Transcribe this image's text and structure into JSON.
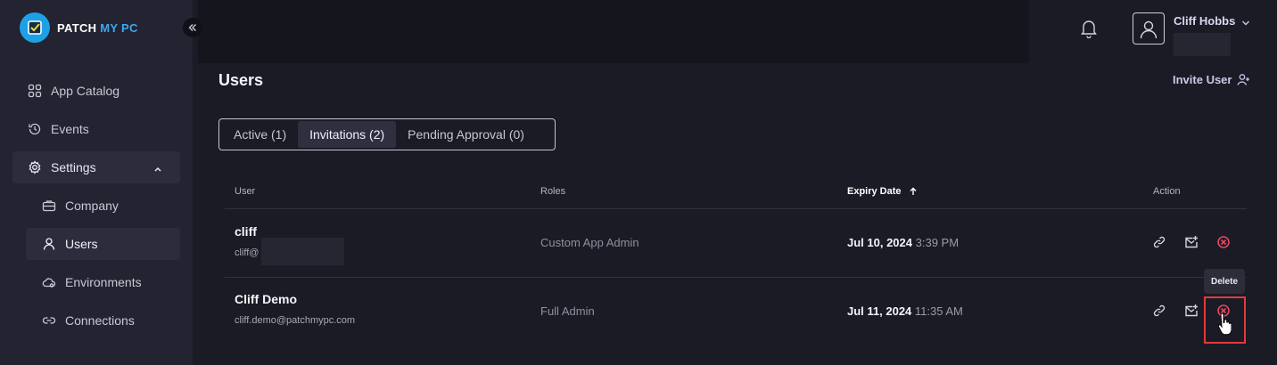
{
  "brand": {
    "name_part1": "PATCH",
    "name_part2": "MY PC",
    "accent": "#3ea7f0"
  },
  "sidebar": {
    "items": [
      {
        "label": "App Catalog",
        "icon": "grid-icon"
      },
      {
        "label": "Events",
        "icon": "history-icon"
      },
      {
        "label": "Settings",
        "icon": "gear-icon"
      },
      {
        "label": "Company",
        "icon": "briefcase-icon"
      },
      {
        "label": "Users",
        "icon": "user-icon"
      },
      {
        "label": "Environments",
        "icon": "cloud-icon"
      },
      {
        "label": "Connections",
        "icon": "link-icon"
      }
    ]
  },
  "header": {
    "user_name": "Cliff Hobbs"
  },
  "page": {
    "title": "Users",
    "invite_label": "Invite User"
  },
  "tabs": [
    "Active (1)",
    "Invitations (2)",
    "Pending Approval (0)"
  ],
  "table": {
    "headers": {
      "user": "User",
      "roles": "Roles",
      "expiry": "Expiry Date",
      "action": "Action"
    },
    "rows": [
      {
        "name": "cliff",
        "email": "cliff@",
        "role": "Custom App Admin",
        "date": "Jul 10, 2024",
        "time": "3:39 PM"
      },
      {
        "name": "Cliff Demo",
        "email": "cliff.demo@patchmypc.com",
        "role": "Full Admin",
        "date": "Jul 11, 2024",
        "time": "11:35 AM"
      }
    ]
  },
  "tooltip": "Delete",
  "colors": {
    "background": "#1b1b26",
    "sidebar": "#232331",
    "delete": "#e8445a",
    "highlight": "#e23a3a"
  }
}
